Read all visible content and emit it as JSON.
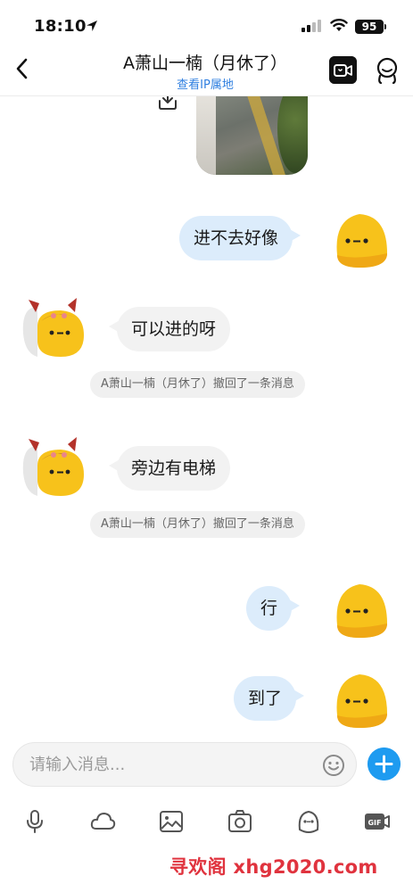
{
  "status_bar": {
    "time": "18:10",
    "battery": "95"
  },
  "header": {
    "title": "A萧山一楠（月休了）",
    "subtitle": "查看IP属地"
  },
  "messages": [
    {
      "side": "out",
      "text": "进不去好像"
    },
    {
      "side": "in",
      "text": "可以进的呀"
    },
    {
      "notice": "A萧山一楠（月休了）撤回了一条消息"
    },
    {
      "side": "in",
      "text": "旁边有电梯"
    },
    {
      "notice": "A萧山一楠（月休了）撤回了一条消息"
    },
    {
      "side": "out",
      "text": "行"
    },
    {
      "side": "out",
      "text": "到了"
    }
  ],
  "input": {
    "placeholder": "请输入消息..."
  },
  "toolbar": [
    "microphone-icon",
    "cloud-icon",
    "image-icon",
    "camera-icon",
    "emoji-face-icon",
    "gif-icon"
  ],
  "watermark": "寻欢阁 xhg2020.com",
  "colors": {
    "accent": "#1e9bf0",
    "outgoing_bubble": "#dcecfb",
    "incoming_bubble": "#f2f2f2",
    "link": "#2f7fe0",
    "watermark": "#e0333e"
  }
}
